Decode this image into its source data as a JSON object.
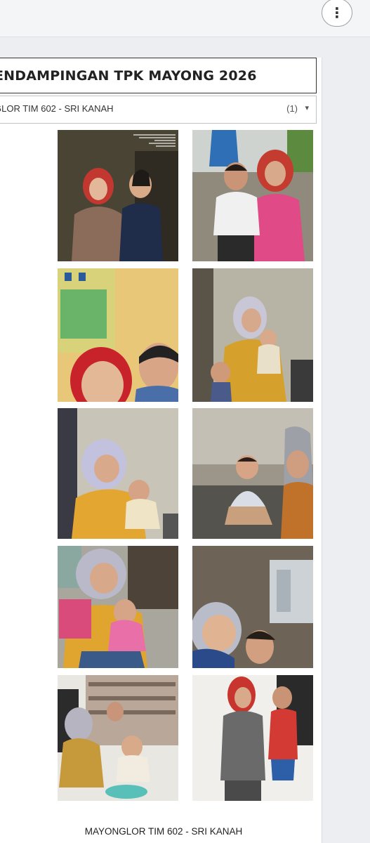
{
  "toolbar": {
    "more_icon": "vertical-ellipsis-icon"
  },
  "report": {
    "title": "ENDAMPINGAN TPK MAYONG 2026",
    "filter": {
      "selected": "GLOR TIM 602 - SRI KANAH",
      "count": "(1)",
      "caret": "▾"
    },
    "photos": [
      {
        "name": "photo-1",
        "subject": "two women standing indoors"
      },
      {
        "name": "photo-2",
        "subject": "woman with child outdoors"
      },
      {
        "name": "photo-3",
        "subject": "selfie woman and boy"
      },
      {
        "name": "photo-4",
        "subject": "elderly woman holding baby"
      },
      {
        "name": "photo-5",
        "subject": "woman holding baby"
      },
      {
        "name": "photo-6",
        "subject": "baby sitting on floor"
      },
      {
        "name": "photo-7",
        "subject": "woman with toddler and book"
      },
      {
        "name": "photo-8",
        "subject": "selfie woman with child"
      },
      {
        "name": "photo-9",
        "subject": "woman with toddler in shop"
      },
      {
        "name": "photo-10",
        "subject": "woman with standing toddler"
      }
    ],
    "caption": "MAYONGLOR TIM 602 - SRI KANAH"
  }
}
